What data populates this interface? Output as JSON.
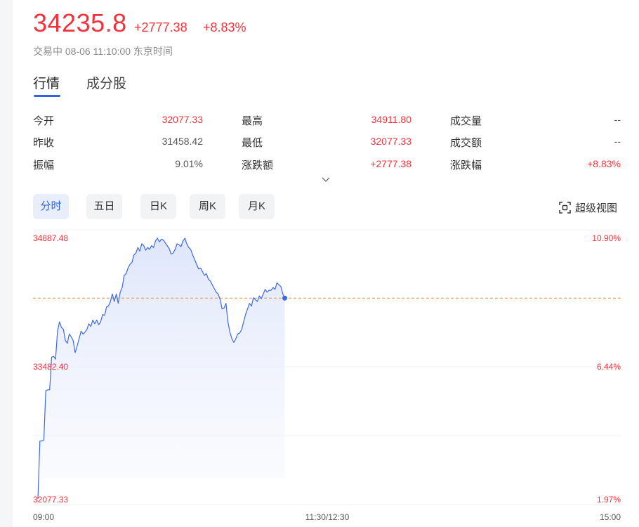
{
  "quote": {
    "price": "34235.8",
    "change": "+2777.38",
    "change_pct": "+8.83%",
    "status": "交易中 08-06 11:10:00 东京时间"
  },
  "tabs": [
    {
      "label": "行情",
      "active": true
    },
    {
      "label": "成分股",
      "active": false
    }
  ],
  "stats": {
    "open": {
      "label": "今开",
      "value": "32077.33"
    },
    "high": {
      "label": "最高",
      "value": "34911.80"
    },
    "volume": {
      "label": "成交量",
      "value": "--"
    },
    "prev_close": {
      "label": "昨收",
      "value": "31458.42"
    },
    "low": {
      "label": "最低",
      "value": "32077.33"
    },
    "turnover": {
      "label": "成交额",
      "value": "--"
    },
    "amplitude": {
      "label": "振幅",
      "value": "9.01%"
    },
    "change_amt": {
      "label": "涨跌额",
      "value": "+2777.38"
    },
    "change_rate": {
      "label": "涨跌幅",
      "value": "+8.83%"
    }
  },
  "periods": [
    {
      "label": "分时",
      "active": true
    },
    {
      "label": "五日",
      "active": false
    },
    {
      "label": "日K",
      "active": false
    },
    {
      "label": "周K",
      "active": false
    },
    {
      "label": "月K",
      "active": false
    }
  ],
  "super_view_label": "超级视图",
  "icons": {
    "expand": "chevron-down-icon",
    "super_view": "fullscreen-icon"
  },
  "colors": {
    "up": "#f0343e",
    "line": "#3d6ae0",
    "accent": "#2f63e0",
    "baseline": "#f08a3c"
  },
  "chart_data": {
    "type": "area",
    "left_ticks": [
      "34887.48",
      "33482.40",
      "32077.33"
    ],
    "right_ticks": [
      "10.90%",
      "6.44%",
      "1.97%"
    ],
    "x_ticks": [
      "09:00",
      "11:30/12:30",
      "15:00"
    ],
    "reference_level": 34235.8,
    "ylim": [
      32077.33,
      34887.48
    ],
    "x_session_minutes": 300,
    "series": [
      {
        "values": [
          32077.33,
          32700,
          32700,
          32710,
          33240,
          33250,
          33250,
          33600,
          33610,
          33580,
          33880,
          33980,
          33920,
          33900,
          33780,
          33750,
          33850,
          33820,
          33780,
          33650,
          33720,
          33800,
          33880,
          33850,
          33870,
          33900,
          33960,
          33930,
          34000,
          33960,
          34000,
          33950,
          33980,
          34060,
          34050,
          34140,
          34150,
          34200,
          34280,
          34200,
          34280,
          34180,
          34300,
          34350,
          34480,
          34500,
          34560,
          34600,
          34620,
          34700,
          34720,
          34780,
          34740,
          34820,
          34800,
          34750,
          34780,
          34760,
          34800,
          34780,
          34850,
          34880,
          34840,
          34870,
          34860,
          34830,
          34800,
          34770,
          34710,
          34720,
          34760,
          34820,
          34810,
          34790,
          34850,
          34880,
          34820,
          34780,
          34760,
          34700,
          34650,
          34600,
          34550,
          34560,
          34520,
          34480,
          34500,
          34440,
          34420,
          34380,
          34340,
          34300,
          34280,
          34220,
          34120,
          34130,
          34180,
          33980,
          33870,
          33800,
          33760,
          33800,
          33850,
          33860,
          33900,
          33980,
          34060,
          34120,
          34180,
          34150,
          34240,
          34220,
          34200,
          34260,
          34230,
          34280,
          34330,
          34300,
          34320,
          34320,
          34350,
          34330,
          34400,
          34380,
          34360,
          34280,
          34235.8
        ]
      }
    ]
  }
}
